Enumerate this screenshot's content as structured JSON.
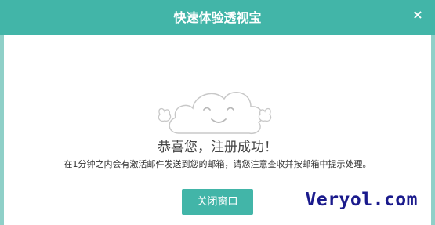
{
  "dialog": {
    "title": "快速体验透视宝",
    "close_label": "×",
    "message_main": "恭喜您，注册成功！",
    "message_sub": "在1分钟之内会有激活邮件发送到您的邮箱，请您注意查收并按邮箱中提示处理。",
    "close_button_label": "关闭窗口"
  },
  "watermark": {
    "text": "Veryol.com"
  },
  "colors": {
    "accent": "#42b5a8",
    "frame": "#8fd0c8",
    "watermark": "#1a1a8c",
    "cloud_stroke": "#c8c8c8"
  },
  "icons": {
    "close": "close-icon",
    "cloud": "smiling-cloud-illustration"
  }
}
